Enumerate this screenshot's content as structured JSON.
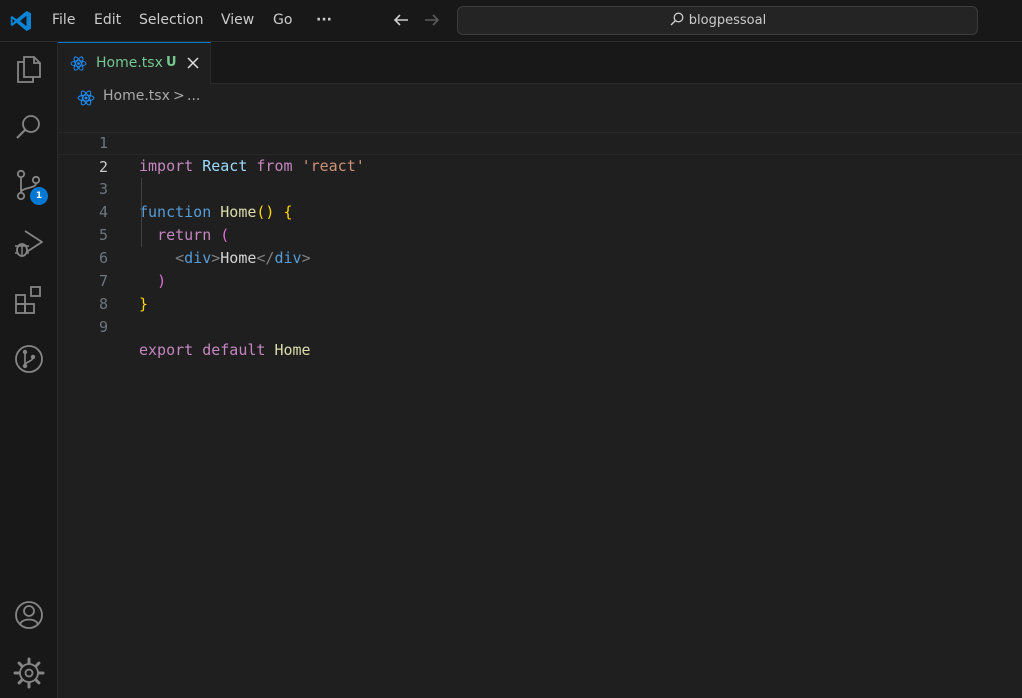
{
  "menu": [
    "File",
    "Edit",
    "Selection",
    "View",
    "Go",
    "···"
  ],
  "search": {
    "text": "blogpessoal"
  },
  "activity": {
    "source_control_badge": "1"
  },
  "tab": {
    "label": "Home.tsx",
    "status": "U"
  },
  "breadcrumb": {
    "file": "Home.tsx",
    "separator": ">",
    "more": "..."
  },
  "editor": {
    "line_numbers": [
      "1",
      "2",
      "3",
      "4",
      "5",
      "6",
      "7",
      "8",
      "9"
    ],
    "tokens": {
      "l1": [
        "import",
        " ",
        "React",
        " ",
        "from",
        " ",
        "'react'"
      ],
      "l3": [
        "function",
        " ",
        "Home",
        "()",
        " ",
        "{"
      ],
      "l4": [
        "  ",
        "return",
        " ",
        "("
      ],
      "l5": [
        "    ",
        "<",
        "div",
        ">",
        "Home",
        "</",
        "div",
        ">"
      ],
      "l6": [
        "  ",
        ")"
      ],
      "l7": [
        "}"
      ],
      "l9": [
        "export",
        " ",
        "default",
        " ",
        "Home"
      ]
    }
  },
  "colors": {
    "accent": "#0078d4",
    "untracked": "#73c991",
    "background": "#1f1f1f",
    "chrome": "#181818"
  }
}
